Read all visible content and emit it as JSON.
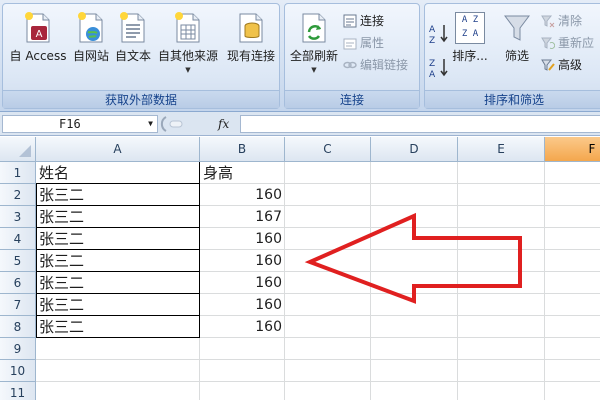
{
  "ribbon": {
    "get_external_data": {
      "group_label": "获取外部数据",
      "buttons": [
        {
          "label": "自 Access",
          "icon": "access-db-icon"
        },
        {
          "label": "自网站",
          "icon": "web-globe-icon"
        },
        {
          "label": "自文本",
          "icon": "text-file-icon"
        },
        {
          "label": "自其他来源",
          "icon": "other-sources-icon",
          "dropdown": "▼"
        },
        {
          "label": "现有连接",
          "icon": "existing-connections-icon"
        }
      ]
    },
    "connections": {
      "group_label": "连接",
      "refresh_all": {
        "label": "全部刷新",
        "icon": "refresh-icon",
        "dropdown": "▼"
      },
      "small": [
        {
          "label": "连接",
          "icon": "connections-icon",
          "enabled": true
        },
        {
          "label": "属性",
          "icon": "properties-icon",
          "enabled": false
        },
        {
          "label": "编辑链接",
          "icon": "edit-links-icon",
          "enabled": false
        }
      ]
    },
    "sort_filter": {
      "group_label": "排序和筛选",
      "sort_asc_icon": "sort-a-z-icon",
      "sort_desc_icon": "sort-z-a-icon",
      "sort": {
        "label": "排序...",
        "icon": "sort-dialog-icon",
        "az_top": "A Z",
        "az_bottom": "Z A"
      },
      "filter": {
        "label": "筛选",
        "icon": "funnel-icon"
      },
      "small": [
        {
          "label": "清除",
          "icon": "clear-filter-icon",
          "enabled": false
        },
        {
          "label": "重新应",
          "icon": "reapply-icon",
          "enabled": false
        },
        {
          "label": "高级",
          "icon": "advanced-filter-icon",
          "enabled": true
        }
      ]
    }
  },
  "formula_bar": {
    "name_box": "F16",
    "name_box_dropdown": "▼",
    "fx": "fx",
    "formula": ""
  },
  "sheet": {
    "columns": [
      "A",
      "B",
      "C",
      "D",
      "E",
      "F"
    ],
    "active_column": "F",
    "rows": [
      "1",
      "2",
      "3",
      "4",
      "5",
      "6",
      "7",
      "8",
      "9",
      "10",
      "11"
    ],
    "header": {
      "name": "姓名",
      "height": "身高"
    },
    "records": [
      {
        "name": "张三二",
        "height": "160"
      },
      {
        "name": "张三二",
        "height": "167"
      },
      {
        "name": "张三二",
        "height": "160"
      },
      {
        "name": "张三二",
        "height": "160"
      },
      {
        "name": "张三二",
        "height": "160"
      },
      {
        "name": "张三二",
        "height": "160"
      },
      {
        "name": "张三二",
        "height": "160"
      }
    ],
    "annotation": {
      "type": "arrow",
      "color": "#e02020",
      "direction": "left"
    }
  },
  "colors": {
    "ribbon_text": "#15428b",
    "active_header": "#f4a74d",
    "annotation_red": "#e02020"
  }
}
